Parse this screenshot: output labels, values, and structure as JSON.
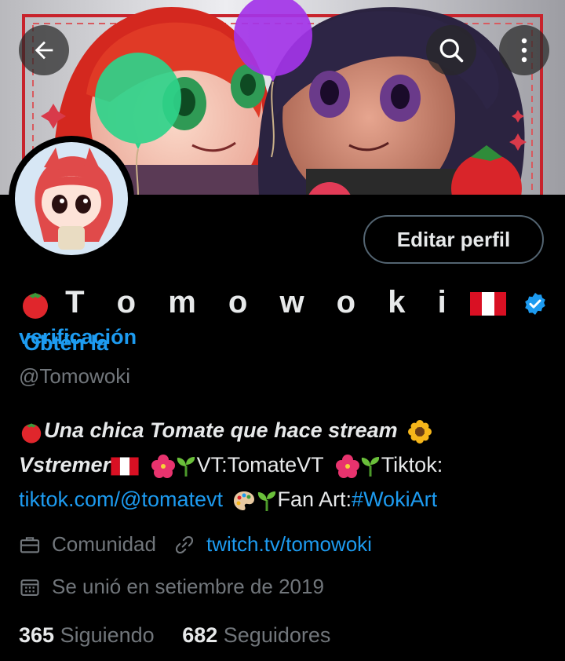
{
  "header": {
    "back_icon": "arrow-left-icon",
    "search_icon": "search-icon",
    "more_icon": "more-vertical-icon"
  },
  "profile": {
    "edit_button_label": "Editar perfil",
    "display_name": "T o m o w o k i",
    "verification_prompt_line1": "Obtén la",
    "verification_prompt_line2": "verificación",
    "handle": "@Tomowoki",
    "bio": {
      "line1_bold": "Una chica Tomate que hace stream",
      "vstremer_bold": "Vstremer",
      "vt_text": "VT:TomateVT",
      "tiktok_label": "Tiktok:",
      "tiktok_link": "tiktok.com/@tomatevt",
      "fanart_label": "Fan Art:",
      "fanart_hashtag": "#WokiArt"
    },
    "category": "Comunidad",
    "website": "twitch.tv/tomowoki",
    "joined": "Se unió en setiembre de 2019",
    "following_count": "365",
    "following_label": "Siguiendo",
    "followers_count": "682",
    "followers_label": "Seguidores"
  },
  "colors": {
    "accent": "#1d9bf0",
    "secondary_text": "#71767b",
    "background": "#000000"
  }
}
